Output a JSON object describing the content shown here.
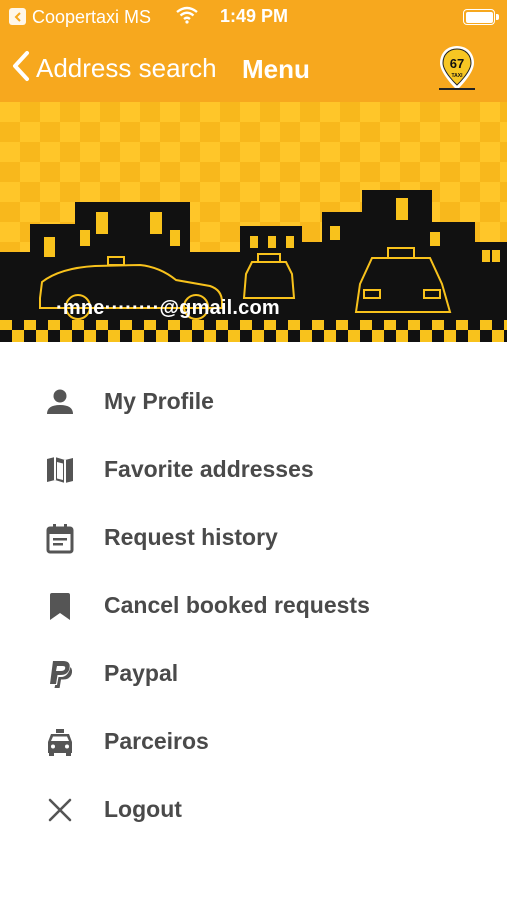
{
  "status_bar": {
    "carrier": "Coopertaxi MS",
    "time": "1:49 PM"
  },
  "nav": {
    "back_label": "Address search",
    "title": "Menu",
    "logo_text": "67",
    "logo_sub": "TAXI"
  },
  "banner": {
    "email": "·mne········@gmail.com"
  },
  "menu": {
    "items": [
      {
        "label": "My Profile",
        "icon": "person-icon"
      },
      {
        "label": "Favorite addresses",
        "icon": "map-icon"
      },
      {
        "label": "Request history",
        "icon": "calendar-icon"
      },
      {
        "label": "Cancel booked requests",
        "icon": "bookmark-icon"
      },
      {
        "label": "Paypal",
        "icon": "paypal-icon"
      },
      {
        "label": "Parceiros",
        "icon": "taxi-icon"
      },
      {
        "label": "Logout",
        "icon": "close-icon"
      }
    ]
  },
  "colors": {
    "accent": "#f7a81e",
    "menu_text": "#4a4a4a",
    "icon": "#555555"
  }
}
